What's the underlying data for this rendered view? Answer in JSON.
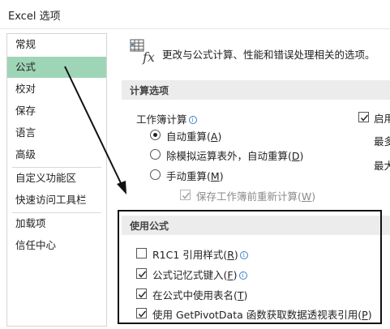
{
  "window": {
    "title": "Excel 选项"
  },
  "sidebar": {
    "items": [
      {
        "label": "常规",
        "selected": false
      },
      {
        "label": "公式",
        "selected": true
      },
      {
        "label": "校对",
        "selected": false
      },
      {
        "label": "保存",
        "selected": false
      },
      {
        "label": "语言",
        "selected": false
      },
      {
        "label": "高级",
        "selected": false
      },
      {
        "label": "自定义功能区",
        "selected": false
      },
      {
        "label": "快速访问工具栏",
        "selected": false
      },
      {
        "label": "加载项",
        "selected": false
      },
      {
        "label": "信任中心",
        "selected": false
      }
    ]
  },
  "header": {
    "icon": "formula-fx-icon",
    "text": "更改与公式计算、性能和错误处理相关的选项。"
  },
  "calc_options": {
    "section_title": "计算选项",
    "workbook_calc_label": "工作簿计算",
    "radios": [
      {
        "label": "自动重算",
        "key": "A",
        "checked": true
      },
      {
        "label": "除模拟运算表外，自动重算",
        "key": "D",
        "checked": false
      },
      {
        "label": "手动重算",
        "key": "M",
        "checked": false
      }
    ],
    "save_recalc": {
      "label": "保存工作簿前重新计算",
      "key": "W",
      "checked": true,
      "disabled": true
    },
    "right_col": {
      "enable_label": "启用",
      "enable_checked": true,
      "max_iter_label": "最多",
      "max_change_label": "最大"
    }
  },
  "formulas": {
    "section_title": "使用公式",
    "options": [
      {
        "label": "R1C1 引用样式",
        "key": "R",
        "checked": false,
        "info": true
      },
      {
        "label": "公式记忆式键入",
        "key": "F",
        "checked": true,
        "info": true
      },
      {
        "label": "在公式中使用表名",
        "key": "T",
        "checked": true,
        "info": false
      },
      {
        "label": "使用 GetPivotData 函数获取数据透视表引用",
        "key": "P",
        "checked": true,
        "info": false
      }
    ]
  },
  "colors": {
    "selected_nav": "#9fd5b7",
    "section_band": "#ececec",
    "info": "#3a7dc9"
  }
}
